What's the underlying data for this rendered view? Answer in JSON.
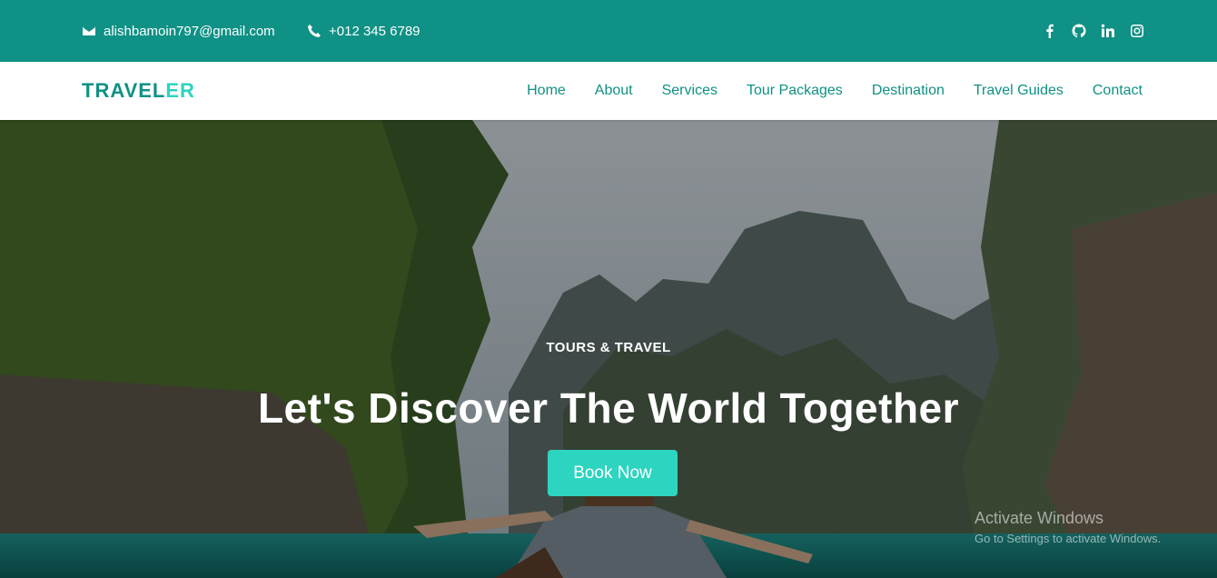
{
  "topbar": {
    "email": "alishbamoin797@gmail.com",
    "phone": "+012 345 6789",
    "socials": [
      "facebook-icon",
      "github-icon",
      "linkedin-icon",
      "instagram-icon"
    ]
  },
  "navbar": {
    "brand_part1": "TRAVEL",
    "brand_part2": "ER",
    "links": [
      "Home",
      "About",
      "Services",
      "Tour Packages",
      "Destination",
      "Travel Guides",
      "Contact"
    ]
  },
  "hero": {
    "eyebrow": "TOURS & TRAVEL",
    "headline": "Let's Discover The World Together",
    "cta_label": "Book Now"
  },
  "watermark": {
    "title": "Activate Windows",
    "subtitle": "Go to Settings to activate Windows."
  },
  "colors": {
    "primary": "#0f9185",
    "accent": "#2dd4bf"
  }
}
